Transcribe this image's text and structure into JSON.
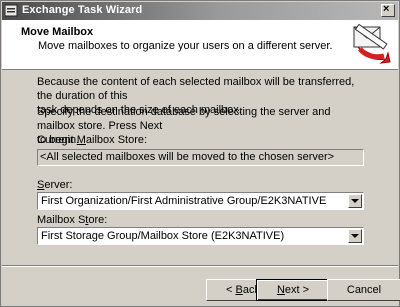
{
  "window": {
    "title": "Exchange Task Wizard"
  },
  "header": {
    "title": "Move Mailbox",
    "subtitle": "Move mailboxes to organize your users on a different server."
  },
  "body": {
    "paragraph1_line1": "Because the content of each selected mailbox will be transferred, the duration of this",
    "paragraph1_line2": "task depends on the size of each mailbox.",
    "paragraph2_line1": "Specify the destination database by selecting the server and mailbox store. Press Next",
    "paragraph2_line2": "to begin.",
    "current_store_label_pre": "Current ",
    "current_store_label_key": "M",
    "current_store_label_post": "ailbox Store:",
    "current_store_value": "<All selected mailboxes will be moved to the chosen server>",
    "server_label_key": "S",
    "server_label_post": "erver:",
    "server_value": "First Organization/First Administrative Group/E2K3NATIVE",
    "mailbox_store_label_pre": "Mailbox S",
    "mailbox_store_label_key": "t",
    "mailbox_store_label_post": "ore:",
    "mailbox_store_value": "First Storage Group/Mailbox Store (E2K3NATIVE)"
  },
  "buttons": {
    "back_arrow": "< ",
    "back_key": "B",
    "back_post": "ack",
    "next_key": "N",
    "next_post": "ext >",
    "cancel": "Cancel"
  },
  "icons": {
    "title": "exchange-wizard-icon",
    "header": "move-mailbox-graphic",
    "combo": "dropdown-arrow-icon",
    "close": "close-icon"
  }
}
